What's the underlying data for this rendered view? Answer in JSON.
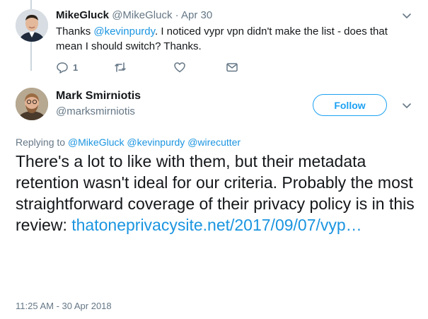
{
  "parent_tweet": {
    "name": "MikeGluck",
    "handle": "@MikeGluck",
    "separator": "·",
    "date": "Apr 30",
    "text_before": "Thanks ",
    "mention": "@kevinpurdy",
    "text_after": ". I noticed vypr vpn didn't make the list - does that mean I should switch? Thanks.",
    "actions": {
      "reply_icon": "reply-icon",
      "reply_count": "1",
      "retweet_icon": "retweet-icon",
      "like_icon": "heart-icon",
      "dm_icon": "envelope-icon"
    }
  },
  "main_tweet": {
    "name": "Mark Smirniotis",
    "handle": "@marksmirniotis",
    "follow_label": "Follow",
    "replying_label": "Replying to",
    "replying_to": "@MikeGluck @kevinpurdy @wirecutter",
    "body": "There's a lot to like with them, but their metadata retention wasn't ideal for our criteria. Probably the most straightforward coverage of their privacy policy is in this review: ",
    "link": "thatoneprivacysite.net/2017/09/07/vyp…",
    "timestamp": "11:25 AM - 30 Apr 2018"
  },
  "colors": {
    "accent": "#1da1f2",
    "link": "#1b95e0",
    "muted": "#657786",
    "text": "#14171a"
  }
}
